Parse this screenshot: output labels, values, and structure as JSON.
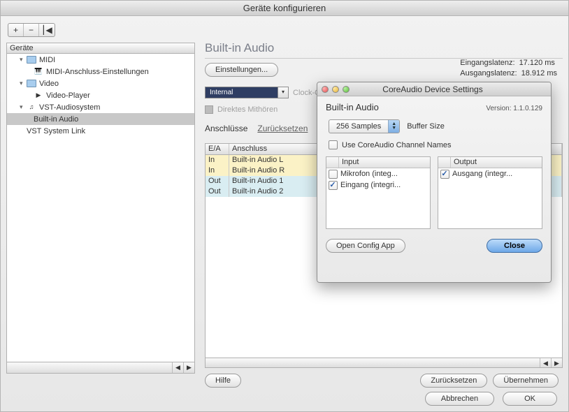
{
  "window": {
    "title": "Geräte konfigurieren"
  },
  "sidebar": {
    "header": "Geräte",
    "items": [
      {
        "label": "MIDI"
      },
      {
        "label": "MIDI-Anschluss-Einstellungen"
      },
      {
        "label": "Video"
      },
      {
        "label": "Video-Player"
      },
      {
        "label": "VST-Audiosystem"
      },
      {
        "label": "Built-in Audio"
      },
      {
        "label": "VST System Link"
      }
    ]
  },
  "panel": {
    "title": "Built-in Audio",
    "settings_btn": "Einstellungen...",
    "latency_in_label": "Eingangslatenz:",
    "latency_in_value": "17.120 ms",
    "latency_out_label": "Ausgangslatenz:",
    "latency_out_value": "18.912 ms",
    "clock_source_value": "Internal",
    "clock_source_label": "Clock-Quelle",
    "direct_monitor": "Direktes Mithören",
    "ports_label": "Anschlüsse",
    "reset_link": "Zurücksetzen",
    "col_ea": "E/A",
    "col_port": "Anschluss",
    "rows": [
      {
        "dir": "In",
        "name": "Built-in Audio L"
      },
      {
        "dir": "In",
        "name": "Built-in Audio R"
      },
      {
        "dir": "Out",
        "name": "Built-in Audio 1"
      },
      {
        "dir": "Out",
        "name": "Built-in Audio 2"
      }
    ],
    "help_btn": "Hilfe",
    "reset_btn": "Zurücksetzen",
    "apply_btn": "Übernehmen"
  },
  "footer": {
    "cancel": "Abbrechen",
    "ok": "OK"
  },
  "dialog": {
    "title": "CoreAudio Device Settings",
    "subtitle": "Built-in Audio",
    "version_label": "Version:",
    "version_value": "1.1.0.129",
    "buffer_value": "256 Samples",
    "buffer_label": "Buffer Size",
    "use_names": "Use CoreAudio Channel Names",
    "input_header": "Input",
    "output_header": "Output",
    "inputs": [
      {
        "label": "Mikrofon (integ...",
        "checked": false
      },
      {
        "label": "Eingang (integri...",
        "checked": true
      }
    ],
    "outputs": [
      {
        "label": "Ausgang (integr...",
        "checked": true
      }
    ],
    "open_config": "Open Config App",
    "close": "Close"
  }
}
